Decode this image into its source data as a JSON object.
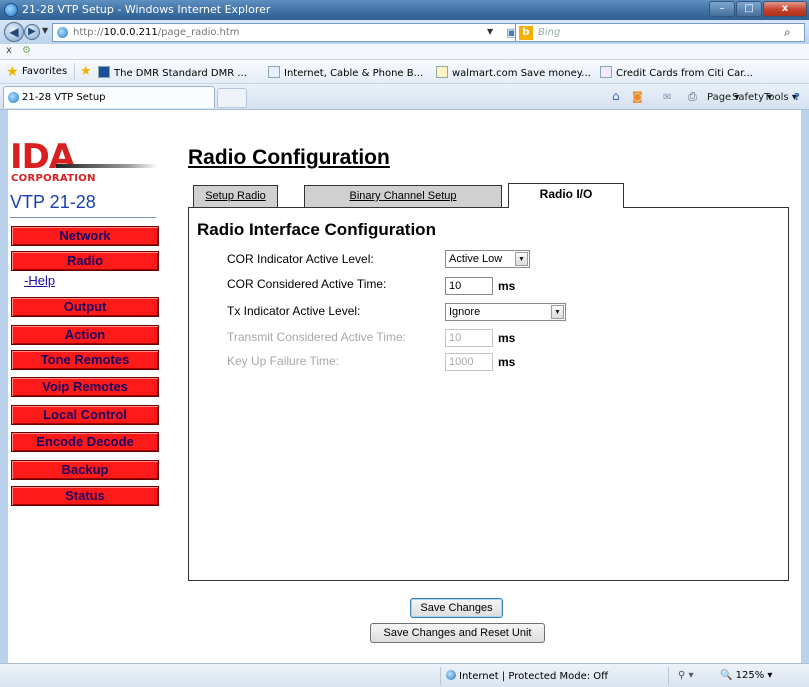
{
  "browser": {
    "window_title": "21-28 VTP Setup - Windows Internet Explorer",
    "window_buttons": {
      "minimize": "–",
      "maximize": "□",
      "close": "x"
    },
    "url_prefix": "http://",
    "url_host": "10.0.0.211",
    "url_path": "/page_radio.htm",
    "search_placeholder": "Bing",
    "search_logo": "b",
    "menu_x": "x",
    "favorites_label": "Favorites",
    "favorites": [
      "The DMR Standard  DMR ...",
      "Internet, Cable & Phone B...",
      "walmart.com  Save money...",
      "Credit Cards from Citi Car..."
    ],
    "tab_title": "21-28 VTP Setup",
    "commands": {
      "page": "Page ▾",
      "safety": "Safety ▾",
      "tools": "Tools ▾"
    }
  },
  "sidebar": {
    "logo_text": "IDA",
    "logo_sub": "CORPORATION",
    "device": "VTP 21-28",
    "items": [
      {
        "label": "Network"
      },
      {
        "label": "Radio"
      },
      {
        "label": "Output"
      },
      {
        "label": "Action"
      },
      {
        "label": "Tone Remotes"
      },
      {
        "label": "Voip Remotes"
      },
      {
        "label": "Local Control"
      },
      {
        "label": "Encode Decode"
      },
      {
        "label": "Backup"
      },
      {
        "label": "Status"
      }
    ],
    "help_link": "-Help"
  },
  "main": {
    "title": "Radio Configuration",
    "tabs": [
      {
        "label": "Setup Radio",
        "active": false
      },
      {
        "label": "Binary Channel Setup",
        "active": false
      },
      {
        "label": "Radio I/O",
        "active": true
      }
    ],
    "section_title": "Radio Interface Configuration",
    "fields": {
      "cor_level": {
        "label": "COR Indicator Active Level:",
        "value": "Active Low"
      },
      "cor_time": {
        "label": "COR Considered Active Time:",
        "value": "10",
        "unit": "ms"
      },
      "tx_level": {
        "label": "Tx Indicator Active Level:",
        "value": "Ignore"
      },
      "tx_time": {
        "label": "Transmit Considered Active Time:",
        "value": "10",
        "unit": "ms",
        "disabled": true
      },
      "keyup_time": {
        "label": "Key Up Failure Time:",
        "value": "1000",
        "unit": "ms",
        "disabled": true
      }
    },
    "buttons": {
      "save": "Save Changes",
      "save_reset": "Save Changes and Reset Unit"
    }
  },
  "statusbar": {
    "zone": "Internet | Protected Mode: Off",
    "zoom": "125%"
  },
  "icons": [
    "ie-logo-icon",
    "back-icon",
    "forward-icon",
    "refresh-icon",
    "stop-icon",
    "search-icon",
    "favorites-star-icon",
    "home-icon",
    "feeds-icon",
    "print-icon",
    "help-icon",
    "globe-icon"
  ]
}
